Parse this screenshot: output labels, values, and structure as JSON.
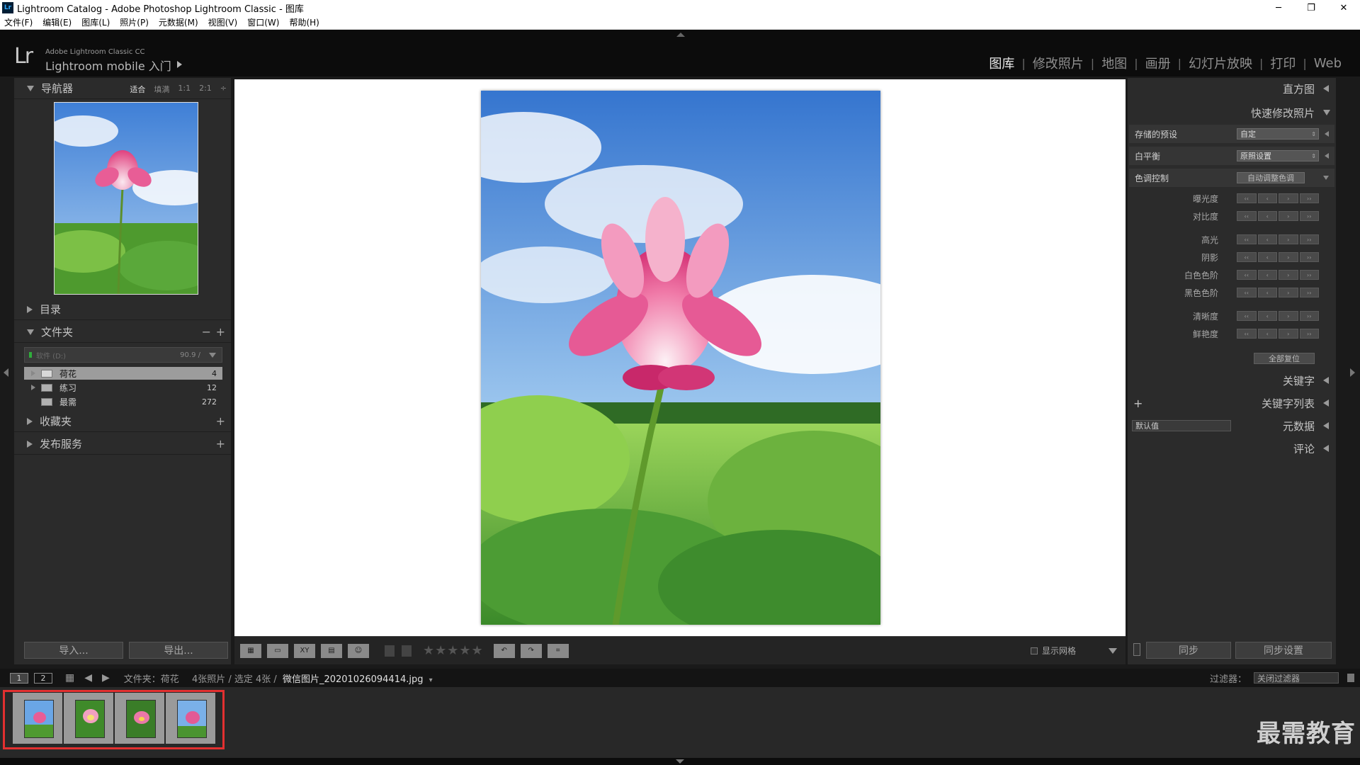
{
  "window": {
    "title": "Lightroom Catalog - Adobe Photoshop Lightroom Classic - 图库",
    "app_icon": "Lr",
    "controls": [
      "─",
      "❐",
      "✕"
    ]
  },
  "menu": [
    "文件(F)",
    "编辑(E)",
    "图库(L)",
    "照片(P)",
    "元数据(M)",
    "视图(V)",
    "窗口(W)",
    "帮助(H)"
  ],
  "identity": {
    "logo": "Lr",
    "product": "Adobe Lightroom Classic CC",
    "tagline": "Lightroom mobile 入门"
  },
  "modules": [
    "图库",
    "修改照片",
    "地图",
    "画册",
    "幻灯片放映",
    "打印",
    "Web"
  ],
  "active_module": "图库",
  "left": {
    "navigator": {
      "title": "导航器",
      "options": [
        "适合",
        "填满",
        "1:1",
        "2:1"
      ],
      "selected_option": "适合",
      "extra": "÷"
    },
    "catalog": {
      "title": "目录"
    },
    "folders": {
      "title": "文件夹",
      "volume_label": "软件 (D:)",
      "volume_size": "90.9 /",
      "items": [
        {
          "name": "荷花",
          "count": "4",
          "selected": true
        },
        {
          "name": "练习",
          "count": "12",
          "selected": false
        },
        {
          "name": "最需",
          "count": "272",
          "selected": false
        }
      ]
    },
    "collections": {
      "title": "收藏夹"
    },
    "publish": {
      "title": "发布服务"
    },
    "import_label": "导入...",
    "export_label": "导出..."
  },
  "right": {
    "histogram": "直方图",
    "quick_develop": "快速修改照片",
    "saved_preset": {
      "label": "存储的预设",
      "value": "自定"
    },
    "white_balance": {
      "label": "白平衡",
      "value": "原照设置"
    },
    "tone_control": {
      "label": "色调控制",
      "value": "自动调整色调"
    },
    "adjustments": [
      "曝光度",
      "对比度",
      "高光",
      "阴影",
      "白色色阶",
      "黑色色阶",
      "清晰度",
      "鲜艳度"
    ],
    "stepper_glyphs": [
      "‹‹",
      "‹",
      "›",
      "››"
    ],
    "reset_all": "全部复位",
    "keywording": "关键字",
    "keyword_list": "关键字列表",
    "metadata": {
      "label": "元数据",
      "preset": "默认值"
    },
    "comments": "评论",
    "sync_label": "同步",
    "sync_settings_label": "同步设置"
  },
  "toolbar": {
    "stars": "★★★★★",
    "show_grid": "显示网格"
  },
  "filterbar": {
    "pages": [
      "1",
      "2"
    ],
    "crumb_prefix": "文件夹：荷花",
    "crumb_count": "4张照片 / 选定 4张 /",
    "filename": "微信图片_20201026094414.jpg",
    "filter_label": "过滤器：",
    "filter_value": "关闭过滤器"
  },
  "watermark": "最需教育",
  "colors": {
    "selection_outline": "#e23030",
    "panel_bg": "#2b2b2b",
    "folder_selected_bg": "#9c9c9c"
  }
}
